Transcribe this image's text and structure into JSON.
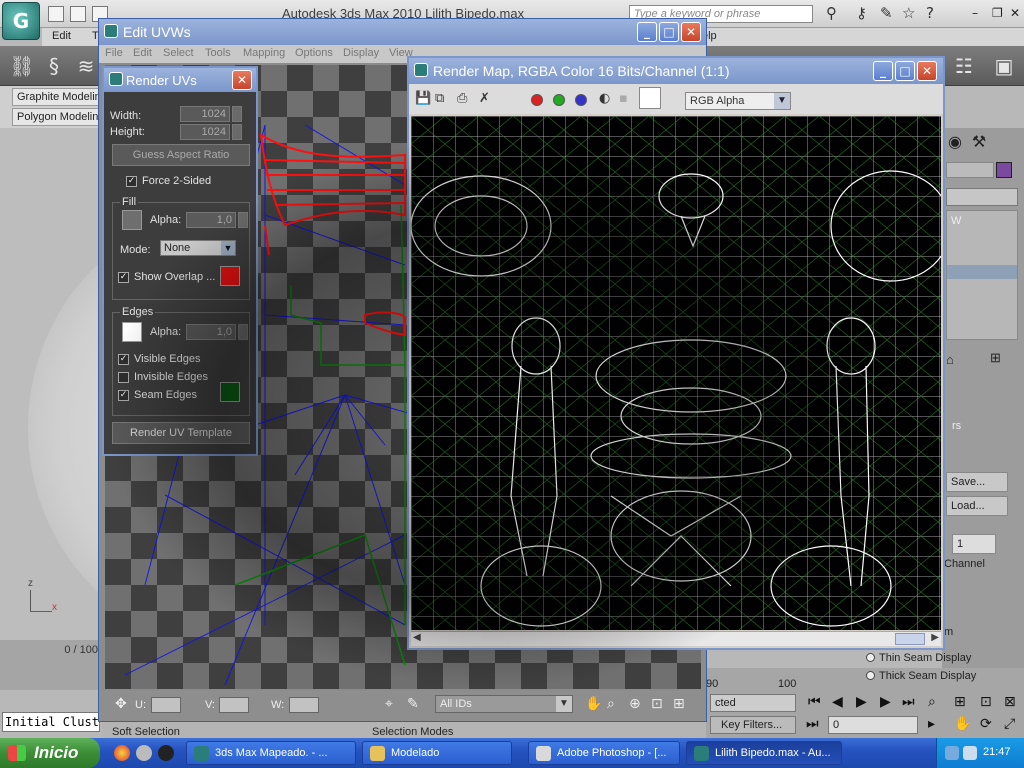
{
  "app": {
    "title": "Autodesk 3ds Max  2010    Lilith Bipedo.max",
    "search_placeholder": "Type a keyword or phrase",
    "menu": [
      "Edit",
      "T",
      "elp"
    ],
    "ribbon_tabs": [
      "Graphite Modeling",
      "Polygon Modeling"
    ],
    "frame_counter": "0 / 100",
    "listener_text": "Initial Clust",
    "bottom_labels": [
      "Soft Selection",
      "Selection Modes"
    ],
    "timeline_numbers": [
      "90",
      "100"
    ],
    "command_panel": {
      "list_text": "W",
      "rollout": "rs",
      "save_button": "Save...",
      "load_button": "Load...",
      "spinner_value": "1",
      "channel_label": "Channel",
      "m_label": "m",
      "thin_seam": "Thin Seam Display",
      "thick_seam": "Thick Seam Display"
    },
    "nav": {
      "selected_label": "cted",
      "key_filters": "Key Filters...",
      "frame_field": "0"
    }
  },
  "edit_uvws": {
    "title": "Edit UVWs",
    "menu": [
      "File",
      "Edit",
      "Select",
      "Tools",
      "Mapping",
      "Options",
      "Display",
      "View"
    ],
    "u_label": "U:",
    "v_label": "V:",
    "w_label": "W:",
    "ids_select": "All IDs"
  },
  "render_uvs": {
    "title": "Render UVs",
    "width_label": "Width:",
    "width_value": "1024",
    "height_label": "Height:",
    "height_value": "1024",
    "guess_aspect": "Guess Aspect Ratio",
    "force_2sided": "Force 2-Sided",
    "fill_label": "Fill",
    "alpha_label": "Alpha:",
    "fill_alpha": "1,0",
    "mode_label": "Mode:",
    "mode_value": "None",
    "show_overlap": "Show Overlap ...",
    "edges_label": "Edges",
    "edges_alpha": "1,0",
    "visible_edges": "Visible Edges",
    "invisible_edges": "Invisible Edges",
    "seam_edges": "Seam Edges",
    "render_template": "Render UV Template",
    "colors": {
      "fill": "#6e6e6e",
      "overlap": "#e01010",
      "edges": "#ffffff",
      "seam": "#0b5a14"
    }
  },
  "render_map": {
    "title": "Render Map, RGBA Color 16 Bits/Channel (1:1)",
    "channel_select": "RGB Alpha"
  },
  "taskbar": {
    "start": "Inicio",
    "tasks": [
      "3ds Max Mapeado. - ...",
      "Modelado",
      "Adobe Photoshop - [...",
      "Lilith Bipedo.max - Au..."
    ],
    "clock": "21:47"
  }
}
